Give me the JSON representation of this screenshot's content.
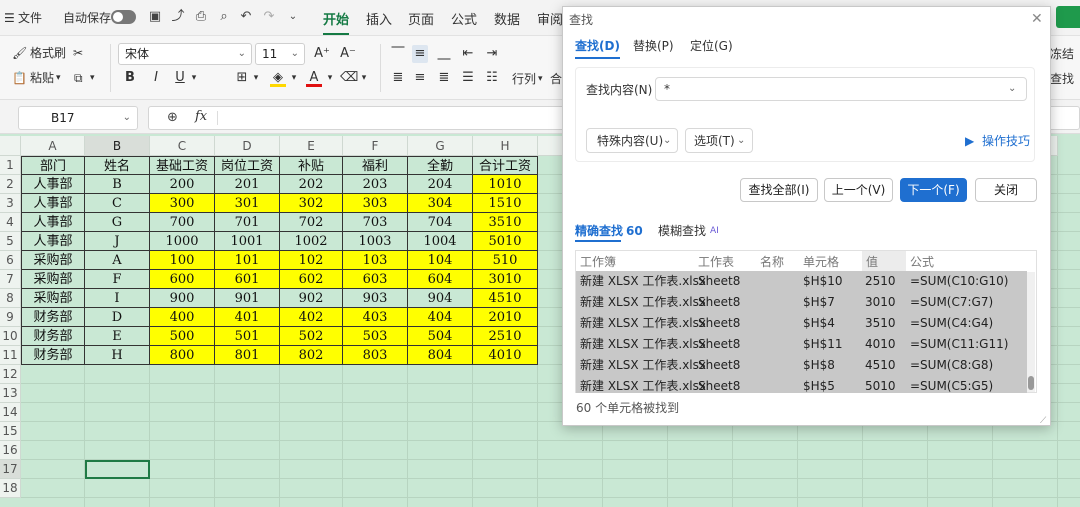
{
  "menu": {
    "file_label": "文件",
    "autosave_label": "自动保存",
    "tabs": [
      "开始",
      "插入",
      "页面",
      "公式",
      "数据",
      "审阅"
    ]
  },
  "ribbon": {
    "format_painter": "格式刷",
    "paste": "粘贴",
    "font_name": "宋体",
    "font_size": "11",
    "bold": "B",
    "italic": "I",
    "underline": "U",
    "font_color_letter": "A",
    "row_col": "行列",
    "merge_partial": "合",
    "freeze": "冻结",
    "find": "查找"
  },
  "formula_bar": {
    "cell_ref": "B17",
    "fx": "fx"
  },
  "sheet": {
    "columns": [
      "A",
      "B",
      "C",
      "D",
      "E",
      "F",
      "G",
      "H"
    ],
    "rows": [
      [
        "部门",
        "姓名",
        "基础工资",
        "岗位工资",
        "补贴",
        "福利",
        "全勤",
        "合计工资"
      ],
      [
        "人事部",
        "B",
        "200",
        "201",
        "202",
        "203",
        "204",
        "1010"
      ],
      [
        "人事部",
        "C",
        "300",
        "301",
        "302",
        "303",
        "304",
        "1510"
      ],
      [
        "人事部",
        "G",
        "700",
        "701",
        "702",
        "703",
        "704",
        "3510"
      ],
      [
        "人事部",
        "J",
        "1000",
        "1001",
        "1002",
        "1003",
        "1004",
        "5010"
      ],
      [
        "采购部",
        "A",
        "100",
        "101",
        "102",
        "103",
        "104",
        "510"
      ],
      [
        "采购部",
        "F",
        "600",
        "601",
        "602",
        "603",
        "604",
        "3010"
      ],
      [
        "采购部",
        "I",
        "900",
        "901",
        "902",
        "903",
        "904",
        "4510"
      ],
      [
        "财务部",
        "D",
        "400",
        "401",
        "402",
        "403",
        "404",
        "2010"
      ],
      [
        "财务部",
        "E",
        "500",
        "501",
        "502",
        "503",
        "504",
        "2510"
      ],
      [
        "财务部",
        "H",
        "800",
        "801",
        "802",
        "803",
        "804",
        "4010"
      ]
    ],
    "highlight_rows": [
      3,
      6,
      7,
      9,
      10,
      11
    ],
    "row_numbers": [
      "1",
      "2",
      "3",
      "4",
      "5",
      "6",
      "7",
      "8",
      "9",
      "10",
      "11",
      "12",
      "13",
      "14",
      "15",
      "16",
      "17",
      "18"
    ],
    "selected_row": "17",
    "selected_col": "B",
    "highlight_color": "#ffff00",
    "sheet_bg": "#c9e8d4"
  },
  "dialog": {
    "title": "查找",
    "tabs": [
      "查找(D)",
      "替换(P)",
      "定位(G)"
    ],
    "find_label": "查找内容(N)",
    "find_value": "*",
    "special_btn": "特殊内容(U)",
    "options_btn": "选项(T)",
    "tips_link": "操作技巧",
    "find_all": "查找全部(I)",
    "prev": "上一个(V)",
    "next": "下一个(F)",
    "close": "关闭",
    "mode_exact": "精确查找",
    "mode_exact_count": "60",
    "mode_fuzzy": "模糊查找",
    "ai_badge": "AI",
    "result_headers": [
      "工作簿",
      "工作表",
      "名称",
      "单元格",
      "值",
      "公式"
    ],
    "results": [
      [
        "新建 XLSX 工作表.xlsx",
        "Sheet8",
        "",
        "$H$10",
        "2510",
        "=SUM(C10:G10)"
      ],
      [
        "新建 XLSX 工作表.xlsx",
        "Sheet8",
        "",
        "$H$7",
        "3010",
        "=SUM(C7:G7)"
      ],
      [
        "新建 XLSX 工作表.xlsx",
        "Sheet8",
        "",
        "$H$4",
        "3510",
        "=SUM(C4:G4)"
      ],
      [
        "新建 XLSX 工作表.xlsx",
        "Sheet8",
        "",
        "$H$11",
        "4010",
        "=SUM(C11:G11)"
      ],
      [
        "新建 XLSX 工作表.xlsx",
        "Sheet8",
        "",
        "$H$8",
        "4510",
        "=SUM(C8:G8)"
      ],
      [
        "新建 XLSX 工作表.xlsx",
        "Sheet8",
        "",
        "$H$5",
        "5010",
        "=SUM(C5:G5)"
      ]
    ],
    "status": "60 个单元格被找到",
    "accent": "#1f6fd0"
  }
}
